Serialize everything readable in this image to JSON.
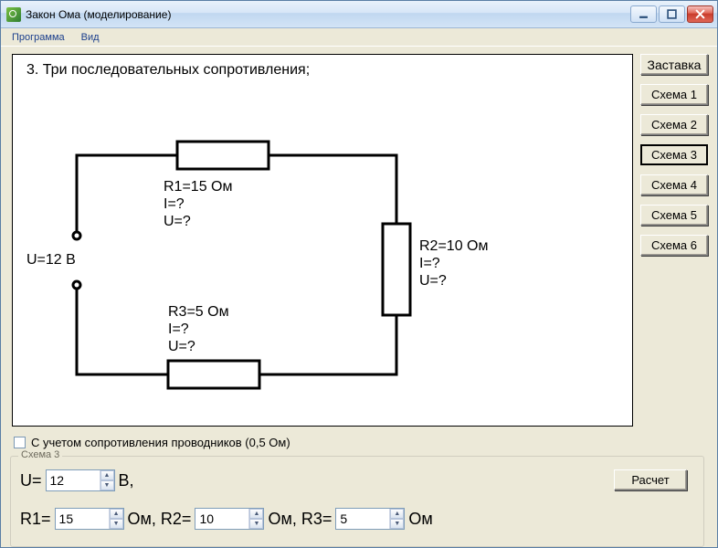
{
  "window": {
    "title": "Закон Ома (моделирование)"
  },
  "menu": {
    "program": "Программа",
    "view": "Вид"
  },
  "diagram": {
    "title": "3. Три последовательных сопротивления;",
    "voltage_label": "U=12 В",
    "r1": "R1=15 Ом\nI=?\nU=?",
    "r2": "R2=10 Ом\nI=?\nU=?",
    "r3": "R3=5 Ом\nI=?\nU=?"
  },
  "sidebar": {
    "b0": "Заставка",
    "b1": "Схема 1",
    "b2": "Схема 2",
    "b3": "Схема 3",
    "b4": "Схема 4",
    "b5": "Схема 5",
    "b6": "Схема 6"
  },
  "checkbox": {
    "label": "С учетом сопротивления проводников (0,5 Ом)"
  },
  "groupbox": {
    "legend": "Схема 3",
    "u_prefix": "U=",
    "u_value": "12",
    "u_suffix": "В,",
    "r1_prefix": "R1=",
    "r1_value": "15",
    "r1_suffix": "Ом, R2=",
    "r2_value": "10",
    "r2_suffix": "Ом, R3=",
    "r3_value": "5",
    "r3_suffix": "Ом",
    "calc": "Расчет"
  },
  "winbtn": {
    "min": "minimize",
    "max": "maximize",
    "close": "close"
  }
}
